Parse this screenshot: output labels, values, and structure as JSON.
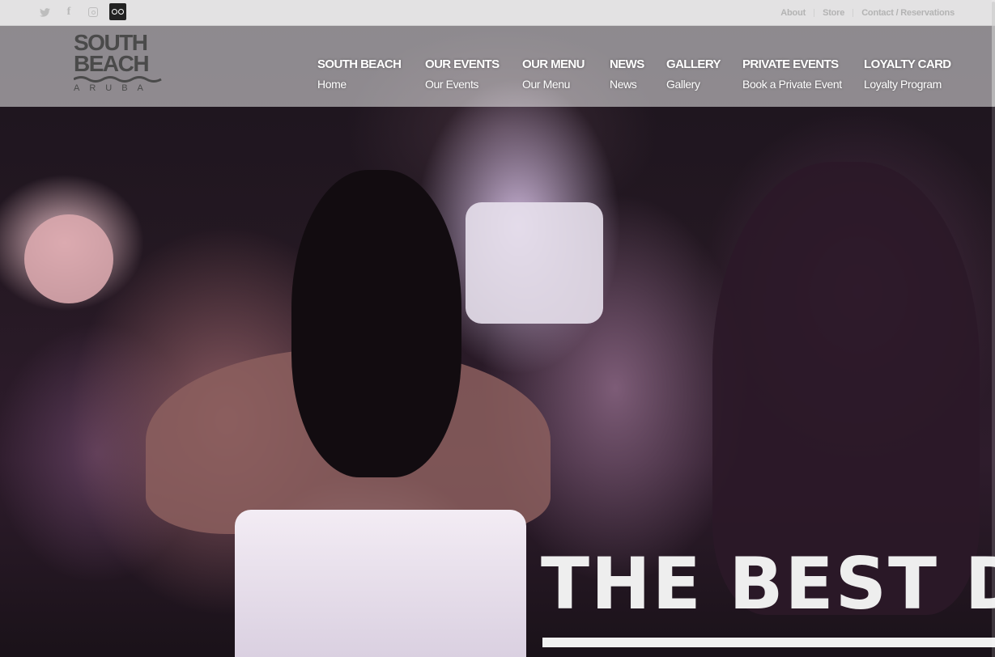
{
  "topbar": {
    "social": [
      {
        "name": "twitter-icon",
        "glyph": "🐦"
      },
      {
        "name": "facebook-icon",
        "glyph": "f"
      },
      {
        "name": "instagram-icon",
        "glyph": ""
      },
      {
        "name": "tripadvisor-icon",
        "glyph": ""
      }
    ],
    "links": {
      "about": "About",
      "store": "Store",
      "contact": "Contact / Reservations"
    }
  },
  "logo": {
    "line1": "SOUTH",
    "line2": "BEACH",
    "sub": "ARUBA"
  },
  "nav": [
    {
      "title": "SOUTH BEACH",
      "sub": "Home"
    },
    {
      "title": "OUR EVENTS",
      "sub": "Our Events"
    },
    {
      "title": "OUR MENU",
      "sub": "Our Menu"
    },
    {
      "title": "NEWS",
      "sub": "News"
    },
    {
      "title": "GALLERY",
      "sub": "Gallery"
    },
    {
      "title": "PRIVATE EVENTS",
      "sub": "Book a Private Event"
    },
    {
      "title": "LOYALTY CARD",
      "sub": "Loyalty Program"
    }
  ],
  "hero": {
    "caption": "THE BEST DJ"
  },
  "colors": {
    "logo": "#4a4a4a",
    "nav_text": "#ffffff",
    "utility_text": "#b3b3b3",
    "topbar_bg": "#f2f2f2"
  }
}
